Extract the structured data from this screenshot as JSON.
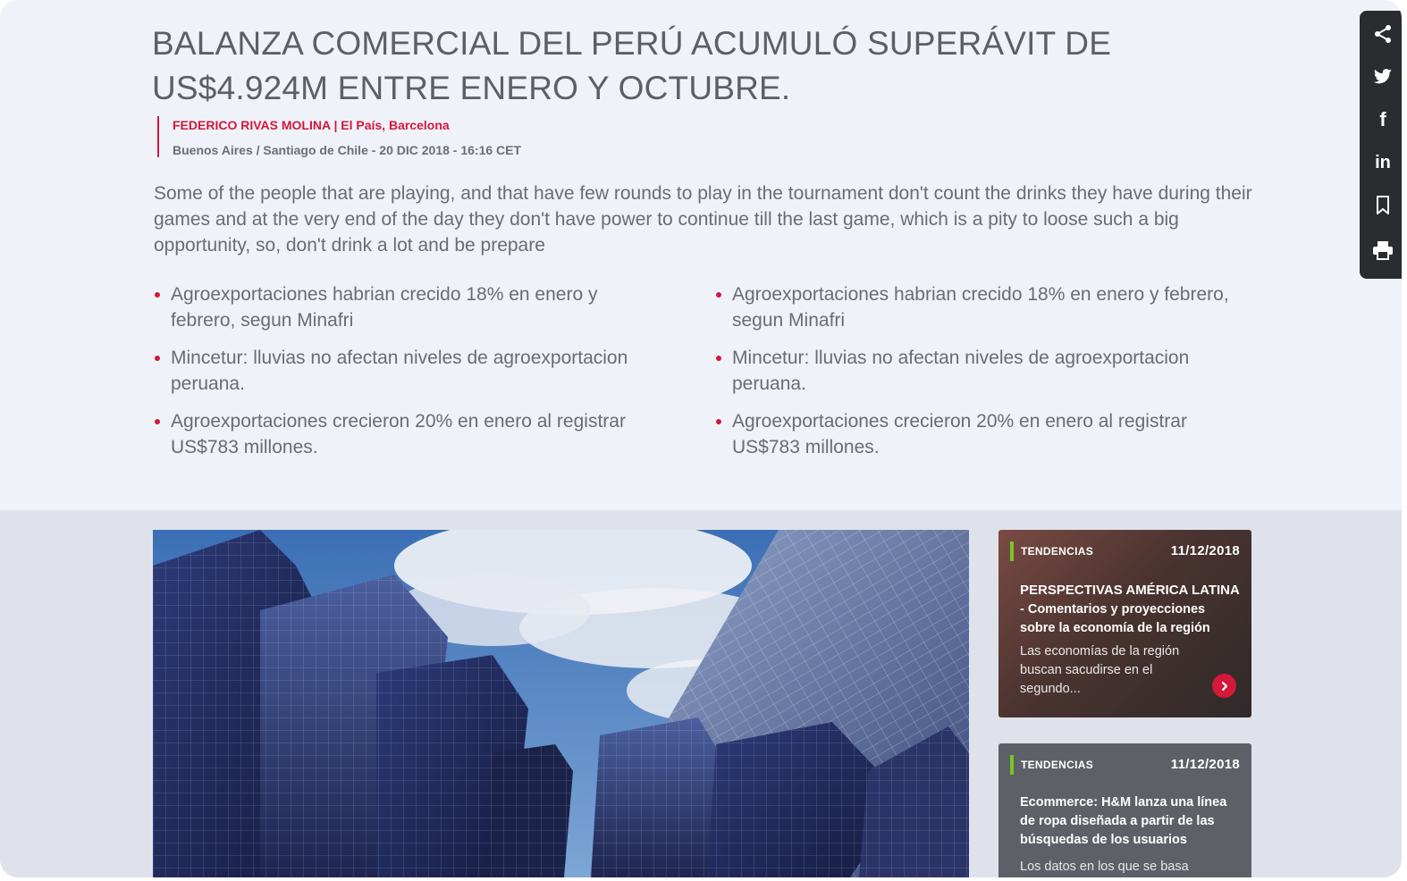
{
  "article": {
    "headline": "BALANZA COMERCIAL DEL PERÚ ACUMULÓ SUPERÁVIT DE US$4.924M ENTRE ENERO Y OCTUBRE.",
    "author": "FEDERICO RIVAS MOLINA",
    "source": "| El País, Barcelona",
    "dateline": "Buenos Aires / Santiago de Chile - 20 DIC 2018 - 16:16 CET",
    "lead": "Some of the people that are playing, and that have few rounds to play in the tournament don't count the drinks they have during their games and at the very end of the day they don't have power to continue till the last game, which is a pity to loose such a big opportunity, so, don't drink a lot and be prepare",
    "bullets_left": [
      "Agroexportaciones habrian crecido 18% en enero y febrero, segun Minafri",
      "Mincetur: lluvias no afectan niveles de agroexportacion peruana.",
      "Agroexportaciones crecieron 20% en enero al registrar US$783 millones."
    ],
    "bullets_right": [
      "Agroexportaciones habrian crecido 18% en enero y febrero, segun Minafri",
      "Mincetur: lluvias no afectan niveles de agroexportacion peruana.",
      "Agroexportaciones crecieron 20% en enero al registrar US$783 millones."
    ]
  },
  "cards": [
    {
      "tag": "TENDENCIAS",
      "date": "11/12/2018",
      "title_caps": "PERSPECTIVAS AMÉRICA LATINA",
      "title_rest": "- Comentarios y proyecciones sobre la economía de la región",
      "desc": "Las economías de la región buscan sacudirse en el segundo..."
    },
    {
      "tag": "TENDENCIAS",
      "date": "11/12/2018",
      "title": "Ecommerce: H&M lanza una línea de ropa diseñada a partir de las búsquedas de los usuarios",
      "desc": "Los datos en los que se basa"
    }
  ],
  "share_bar": {
    "icons": [
      "share-icon",
      "twitter-icon",
      "facebook-icon",
      "linkedin-icon",
      "bookmark-icon",
      "print-icon"
    ],
    "facebook_glyph": "f",
    "linkedin_glyph": "in"
  },
  "colors": {
    "accent": "#d3183a",
    "tag_bar": "#7cc421",
    "share_bg": "#2b2c30"
  }
}
